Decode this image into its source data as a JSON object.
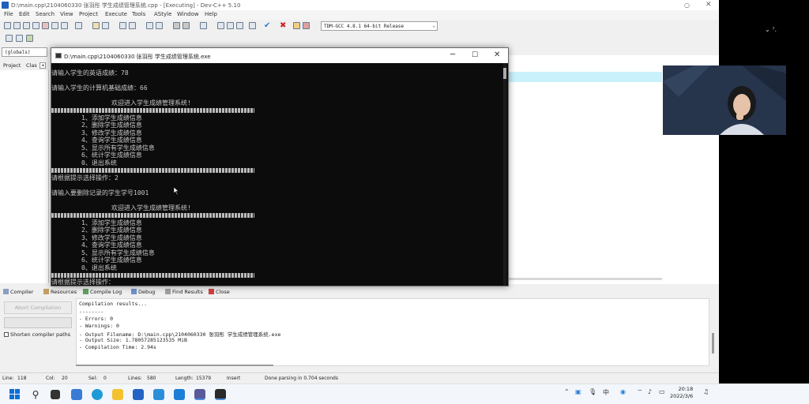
{
  "ide": {
    "title": "D:\\main.cpp\\2104060330 张羽彤 学生成绩管理系统.cpp - [Executing] - Dev-C++ 5.10",
    "menu": [
      "File",
      "Edit",
      "Search",
      "View",
      "Project",
      "Execute",
      "Tools",
      "AStyle",
      "Window",
      "Help"
    ],
    "compiler_select": "TDM-GCC 4.8.1 64-bit Release",
    "scope_select": "(globals)",
    "left_tabs": [
      "Project",
      "Classes"
    ],
    "corner_text": "⌄ ⁷.",
    "bottom_tabs": [
      "Compiler",
      "Resources",
      "Compile Log",
      "Debug",
      "Find Results",
      "Close"
    ],
    "abort_label": "Abort Compilation",
    "shorten_label": "Shorten compiler paths",
    "log_lines": [
      "Compilation results...",
      "--------",
      "- Errors: 0",
      "- Warnings: 0",
      "- Output Filename: D:\\main.cpp\\2104060330 张羽彤 学生成绩管理系统.exe",
      "- Output Size: 1.78057285123535 MiB",
      "- Compilation Time: 2.94s"
    ],
    "status": {
      "line_label": "Line:",
      "line": "118",
      "col_label": "Col:",
      "col": "20",
      "sel_label": "Sel:",
      "sel": "0",
      "lines_label": "Lines:",
      "lines": "580",
      "length_label": "Length:",
      "length": "15379",
      "mode": "Insert",
      "message": "Done parsing in 0.704 seconds"
    }
  },
  "console": {
    "title": "D:\\main.cpp\\2104060330 张羽彤 学生成绩管理系统.exe",
    "lines": {
      "english": "请输入学生的英语成绩：78",
      "computer": "请输入学生的计算机基础成绩：66",
      "welcome1": "欢迎进入学生成绩管理系统!",
      "m1_1": "1、添加学生成绩信息",
      "m1_2": "2、删除学生成绩信息",
      "m1_3": "3、修改学生成绩信息",
      "m1_4": "4、查询学生成绩信息",
      "m1_5": "5、显示所有学生成绩信息",
      "m1_6": "6、统计学生成绩信息",
      "m1_0": "0、退出系统",
      "choose1": "请根据提示选择操作：2",
      "delete_prompt": "请输入要删除记录的学生学号1001",
      "welcome2": "欢迎进入学生成绩管理系统!",
      "m2_1": "1、添加学生成绩信息",
      "m2_2": "2、删除学生成绩信息",
      "m2_3": "3、修改学生成绩信息",
      "m2_4": "4、查询学生成绩信息",
      "m2_5": "5、显示所有学生成绩信息",
      "m2_6": "6、统计学生成绩信息",
      "m2_0": "0、退出系统",
      "choose2": "请根据提示选择操作："
    }
  },
  "taskbar": {
    "time": "20:18",
    "date": "2022/3/6"
  }
}
